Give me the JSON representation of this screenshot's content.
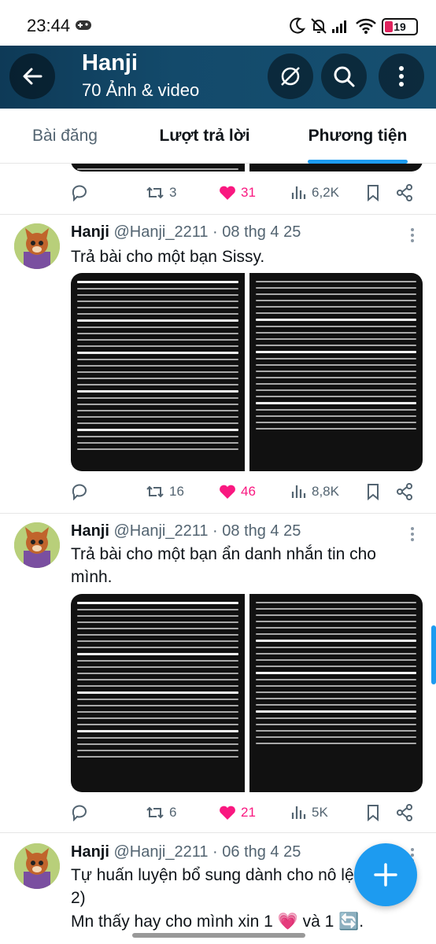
{
  "status_bar": {
    "time": "23:44",
    "battery": "19"
  },
  "header": {
    "title": "Hanji",
    "subtitle": "70 Ảnh & video"
  },
  "tabs": [
    {
      "label": "Bài đăng"
    },
    {
      "label": "Lượt trả lời"
    },
    {
      "label": "Phương tiện"
    }
  ],
  "tweets": [
    {
      "stats": {
        "replies": "",
        "retweets": "3",
        "likes": "31",
        "views": "6,2K"
      }
    },
    {
      "name": "Hanji",
      "handle": "@Hanji_2211",
      "time": "08 thg 4 25",
      "text": "Trả bài cho một bạn Sissy.",
      "stats": {
        "replies": "",
        "retweets": "16",
        "likes": "46",
        "views": "8,8K"
      }
    },
    {
      "name": "Hanji",
      "handle": "@Hanji_2211",
      "time": "08 thg 4 25",
      "text": "Trả bài cho một bạn ẩn danh nhắn tin cho mình.",
      "stats": {
        "replies": "",
        "retweets": "6",
        "likes": "21",
        "views": "5K"
      }
    },
    {
      "name": "Hanji",
      "handle": "@Hanji_2211",
      "time": "06 thg 4 25",
      "text": "Tự huấn luyện bổ sung dành cho nô lệ (Phần 2)",
      "text2": "Mn thấy hay cho mình xin 1 💗 và 1 🔄."
    }
  ],
  "colors": {
    "accent": "#1d9bf0",
    "like": "#f91880",
    "header": "#134a6b"
  }
}
